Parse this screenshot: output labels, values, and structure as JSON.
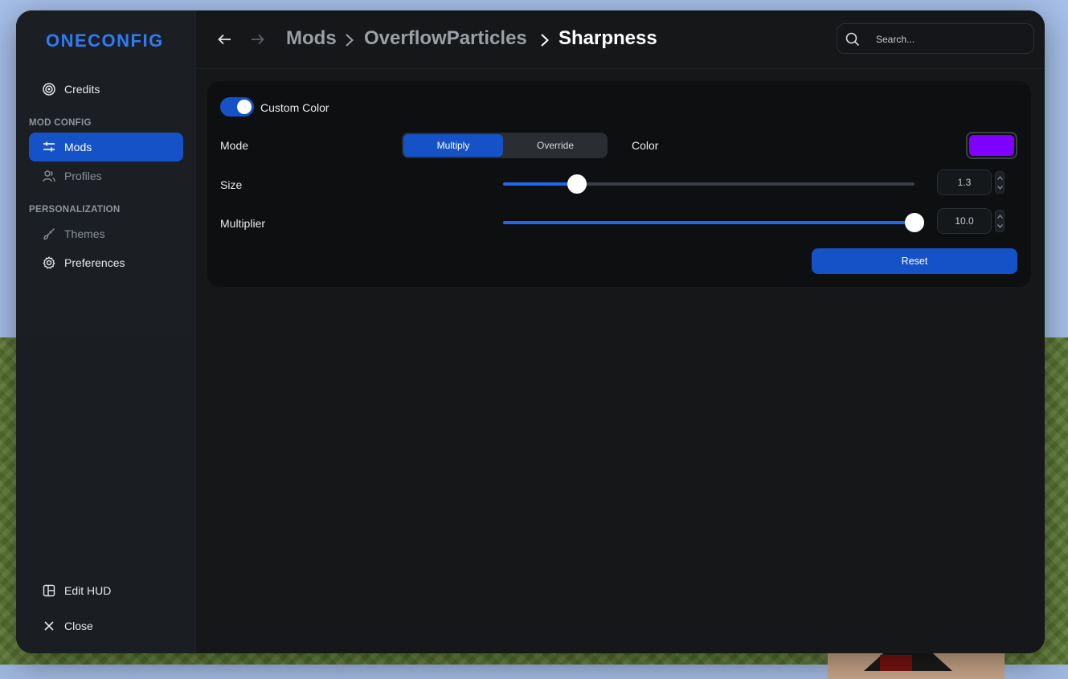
{
  "app": {
    "logo_text": "ONECONFIG",
    "accent": "#2f7bf5",
    "primary": "#1552c7"
  },
  "sidebar": {
    "credits": {
      "label": "Credits",
      "icon": "target-icon"
    },
    "mod_config_heading": "MOD CONFIG",
    "mods": {
      "label": "Mods",
      "icon": "sliders-icon",
      "active": true
    },
    "profiles": {
      "label": "Profiles",
      "icon": "users-icon"
    },
    "personalization_heading": "PERSONALIZATION",
    "themes": {
      "label": "Themes",
      "icon": "brush-icon"
    },
    "preferences": {
      "label": "Preferences",
      "icon": "gear-icon"
    },
    "edit_hud": {
      "label": "Edit HUD",
      "icon": "layout-icon"
    },
    "close": {
      "label": "Close",
      "icon": "close-icon"
    }
  },
  "header": {
    "breadcrumb": [
      "Mods",
      "OverflowParticles",
      "Sharpness"
    ],
    "search_placeholder": "Search..."
  },
  "settings": {
    "custom_color": {
      "label": "Custom Color",
      "enabled": true
    },
    "mode": {
      "label": "Mode",
      "options": [
        "Multiply",
        "Override"
      ],
      "selected": "Multiply"
    },
    "color": {
      "label": "Color",
      "value": "#8000ff"
    },
    "size": {
      "label": "Size",
      "value": "1.3",
      "fraction": 0.18
    },
    "multiplier": {
      "label": "Multiplier",
      "value": "10.0",
      "fraction": 1.0
    },
    "reset_label": "Reset"
  }
}
